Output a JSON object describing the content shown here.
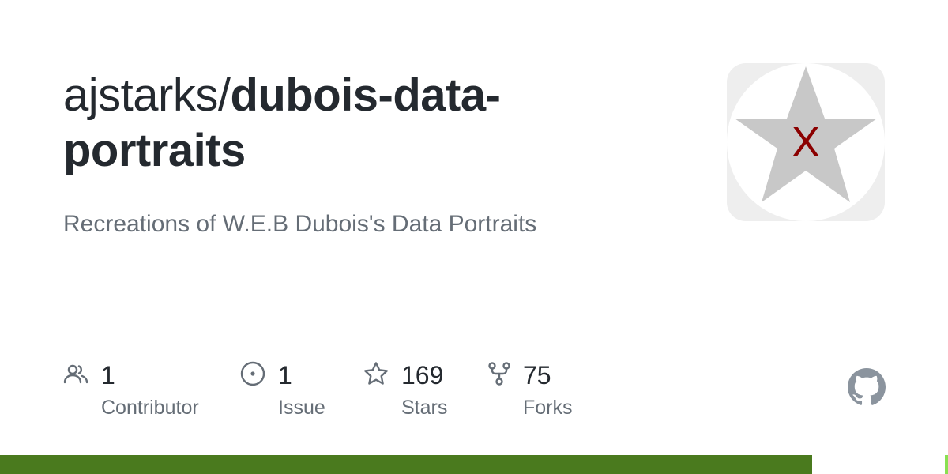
{
  "repo": {
    "owner": "ajstarks/",
    "name": "dubois-data-portraits",
    "description": "Recreations of W.E.B Dubois's Data Portraits"
  },
  "avatar": {
    "mark": "X",
    "star_color": "#c8c8c8",
    "mark_color": "#8b0000",
    "background": "#eeeeee"
  },
  "stats": [
    {
      "icon": "people-icon",
      "count": "1",
      "label": "Contributor"
    },
    {
      "icon": "issue-icon",
      "count": "1",
      "label": "Issue"
    },
    {
      "icon": "star-icon",
      "count": "169",
      "label": "Stars"
    },
    {
      "icon": "fork-icon",
      "count": "75",
      "label": "Forks"
    }
  ],
  "colors": {
    "text_primary": "#24292f",
    "text_muted": "#656d76",
    "icon": "#656d76",
    "github_mark": "#8b949e"
  },
  "language_bar": [
    {
      "share": 0.857,
      "color": "#4a7a1e"
    },
    {
      "share": 0.14,
      "color": "#ffffff"
    },
    {
      "share": 0.003,
      "color": "#89e051"
    }
  ]
}
